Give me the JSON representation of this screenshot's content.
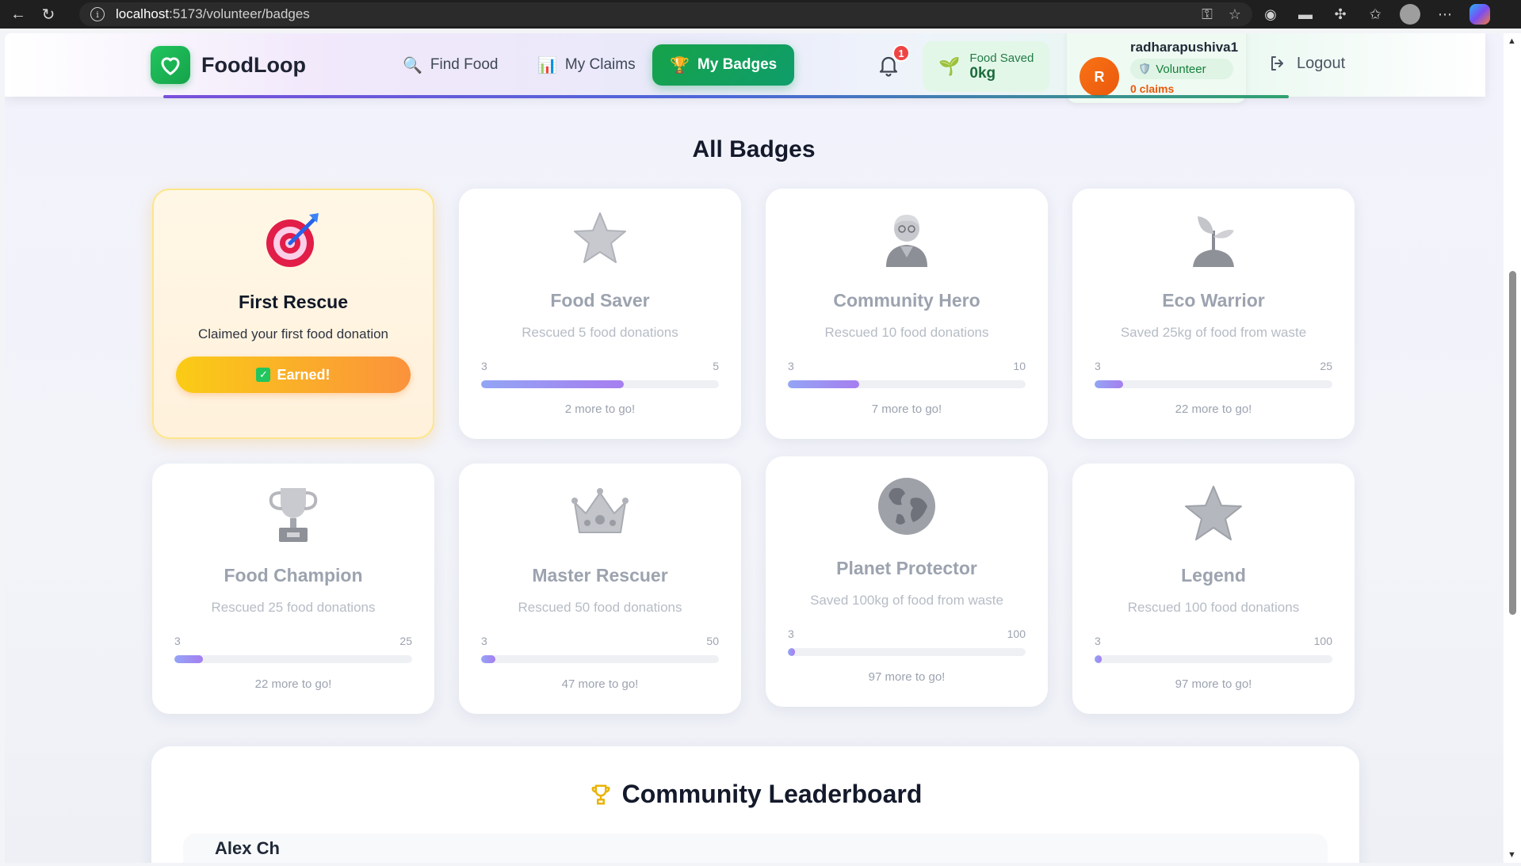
{
  "browser": {
    "url_host": "localhost",
    "url_path": ":5173/volunteer/badges"
  },
  "nav": {
    "brand": "FoodLoop",
    "links": [
      {
        "label": "Find Food",
        "icon": "search-icon"
      },
      {
        "label": "My Claims",
        "icon": "chart-icon"
      },
      {
        "label": "My Badges",
        "icon": "trophy-icon",
        "active": true
      }
    ],
    "notification_count": "1",
    "food_saved_label": "Food Saved",
    "food_saved_value": "0kg",
    "user": {
      "initial": "R",
      "name": "radharapushiva1",
      "role": "Volunteer",
      "claims": "0 claims"
    },
    "logout_label": "Logout"
  },
  "section_title": "All Badges",
  "badges": [
    {
      "title": "First Rescue",
      "desc": "Claimed your first food donation",
      "earned": true,
      "earned_label": "Earned!",
      "icon": "target-icon"
    },
    {
      "title": "Food Saver",
      "desc": "Rescued 5 food donations",
      "current": "3",
      "goal": "5",
      "progress": 0.6,
      "note": "2 more to go!",
      "icon": "star-icon"
    },
    {
      "title": "Community Hero",
      "desc": "Rescued 10 food donations",
      "current": "3",
      "goal": "10",
      "progress": 0.3,
      "note": "7 more to go!",
      "icon": "hero-icon"
    },
    {
      "title": "Eco Warrior",
      "desc": "Saved 25kg of food from waste",
      "current": "3",
      "goal": "25",
      "progress": 0.12,
      "note": "22 more to go!",
      "icon": "sprout-icon"
    },
    {
      "title": "Food Champion",
      "desc": "Rescued 25 food donations",
      "current": "3",
      "goal": "25",
      "progress": 0.12,
      "note": "22 more to go!",
      "icon": "trophy-icon"
    },
    {
      "title": "Master Rescuer",
      "desc": "Rescued 50 food donations",
      "current": "3",
      "goal": "50",
      "progress": 0.06,
      "note": "47 more to go!",
      "icon": "crown-icon"
    },
    {
      "title": "Planet Protector",
      "desc": "Saved 100kg of food from waste",
      "current": "3",
      "goal": "100",
      "progress": 0.03,
      "note": "97 more to go!",
      "icon": "globe-icon"
    },
    {
      "title": "Legend",
      "desc": "Rescued 100 food donations",
      "current": "3",
      "goal": "100",
      "progress": 0.03,
      "note": "97 more to go!",
      "icon": "star-icon"
    }
  ],
  "leaderboard": {
    "title": "Community Leaderboard",
    "first_name": "Alex Ch"
  },
  "colors": {
    "accent_green": "#16a34a",
    "earned_gradient_start": "#facc15",
    "earned_gradient_end": "#fb923c",
    "progress_start": "#93a5f5",
    "progress_end": "#a67ef0"
  }
}
